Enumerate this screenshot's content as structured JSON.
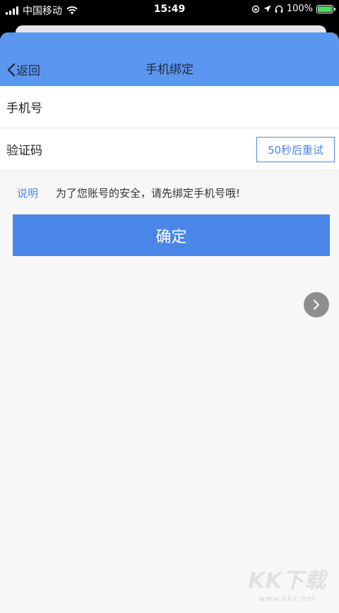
{
  "status_bar": {
    "carrier": "中国移动",
    "time": "15:49",
    "battery": "100%",
    "battery_level": 1.0
  },
  "nav": {
    "back_label": "返回",
    "title": "手机绑定"
  },
  "form": {
    "phone": {
      "label": "手机号",
      "value": ""
    },
    "code": {
      "label": "验证码",
      "value": "",
      "retry_label": "50秒后重试"
    }
  },
  "note": {
    "label": "说明",
    "text": "为了您账号的安全，请先绑定手机号哦!"
  },
  "confirm_label": "确定",
  "watermark": {
    "logo": "KK下载",
    "url": "www.kkx.net"
  },
  "colors": {
    "nav_bg": "#5b97f0",
    "accent": "#4a86e8",
    "page_bg": "#f7f7f7"
  }
}
